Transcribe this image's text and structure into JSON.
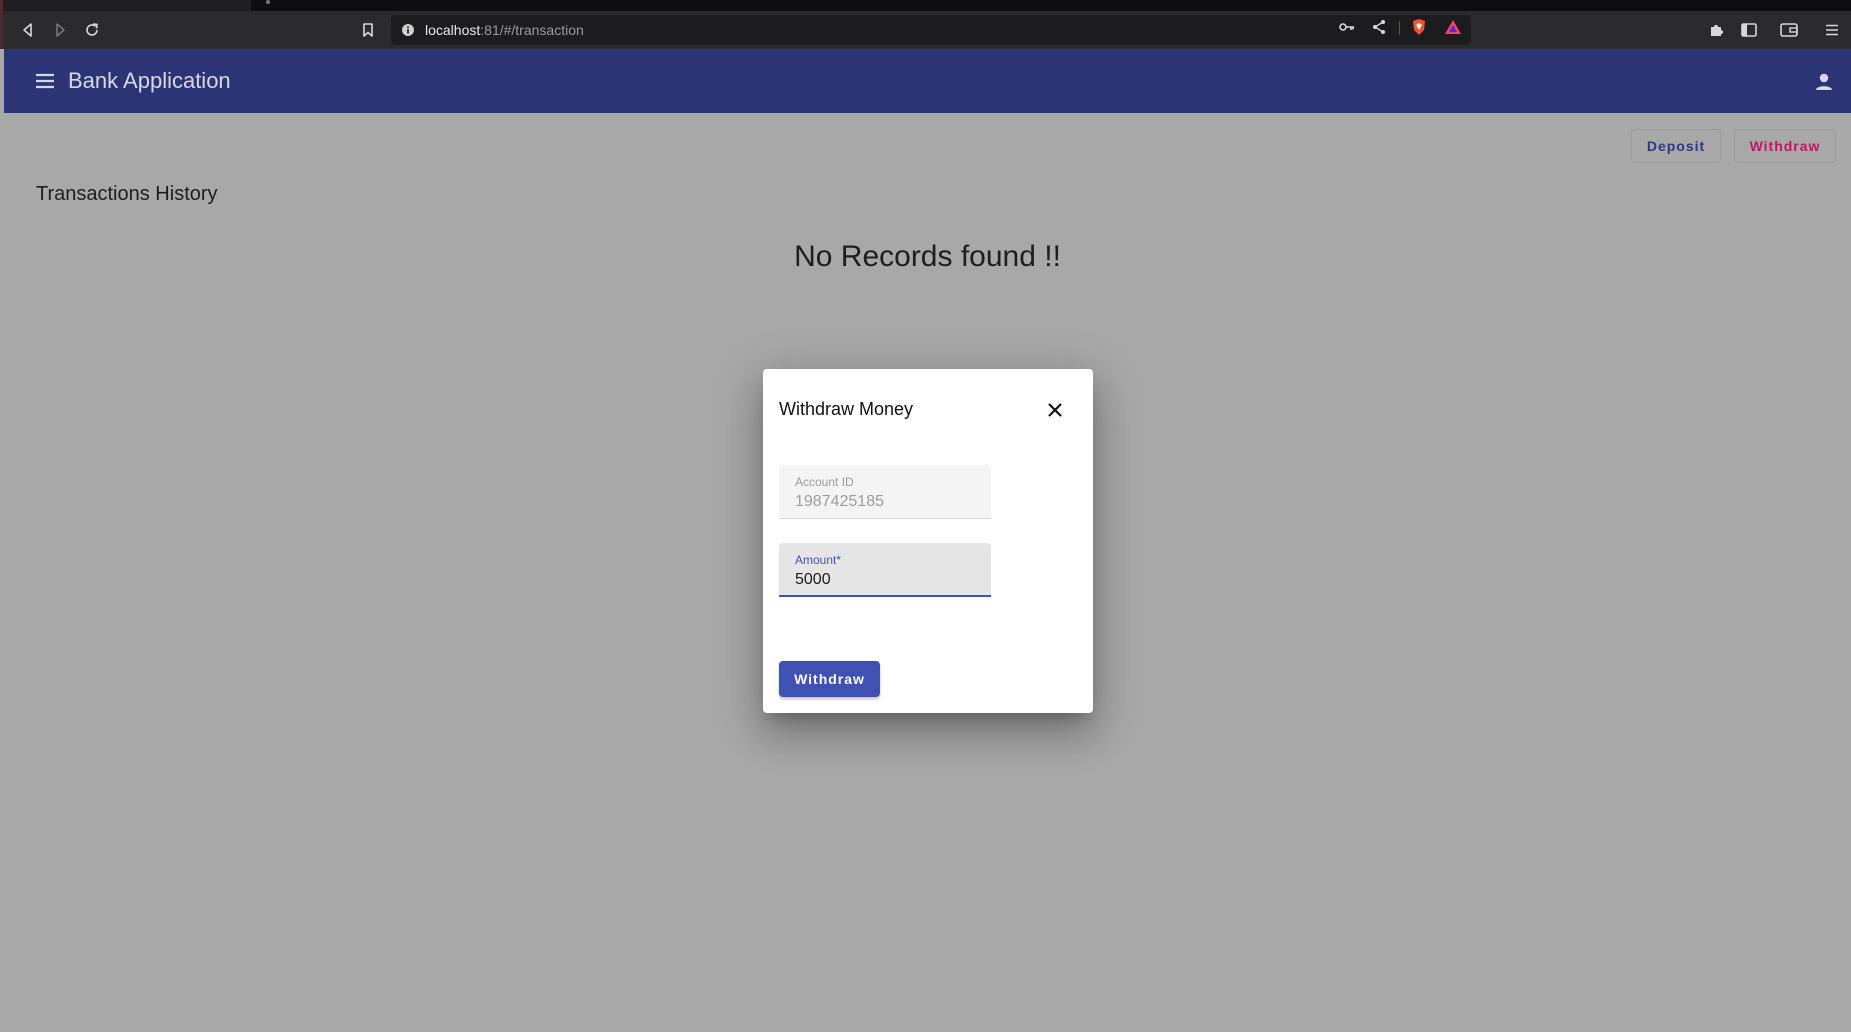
{
  "browser": {
    "url_host": "localhost",
    "url_rest": ":81/#/transaction"
  },
  "app": {
    "title": "Bank Application",
    "colors": {
      "primary": "#2b3576",
      "accent": "#c2185b",
      "button": "#3f51b5"
    }
  },
  "actions": {
    "deposit_label": "Deposit",
    "withdraw_label": "Withdraw"
  },
  "page": {
    "section_title": "Transactions History",
    "empty_message": "No Records found !!"
  },
  "dialog": {
    "title": "Withdraw Money",
    "account_field": {
      "label": "Account ID",
      "value": "1987425185"
    },
    "amount_field": {
      "label": "Amount*",
      "value": "5000"
    },
    "submit_label": "Withdraw"
  },
  "icons": [
    "back-icon",
    "forward-icon",
    "reload-icon",
    "bookmark-icon",
    "info-icon",
    "key-icon",
    "share-icon",
    "brave-shield-icon",
    "brave-rewards-icon",
    "extensions-icon",
    "sidebar-icon",
    "wallet-icon",
    "browser-menu-icon",
    "menu-icon",
    "account-icon",
    "close-icon"
  ]
}
